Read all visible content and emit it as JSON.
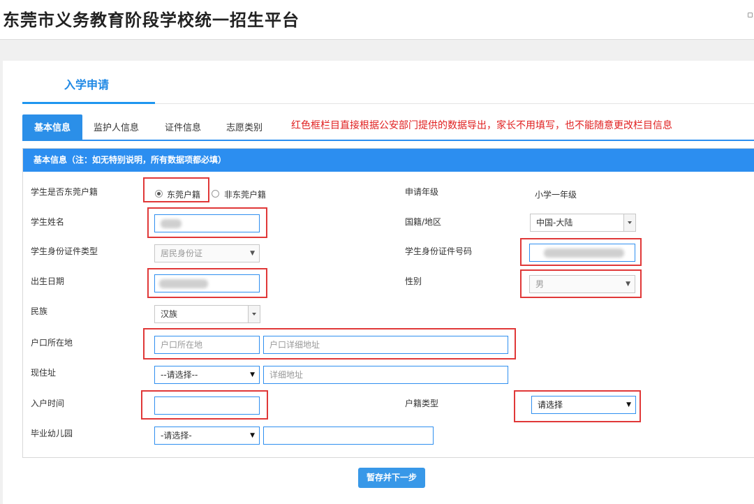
{
  "header": {
    "title": "东莞市义务教育阶段学校统一招生平台"
  },
  "page_tab": {
    "label": "入学申请"
  },
  "tabs": [
    {
      "label": "基本信息"
    },
    {
      "label": "监护人信息"
    },
    {
      "label": "证件信息"
    },
    {
      "label": "志愿类别"
    }
  ],
  "notice": "红色框栏目直接根据公安部门提供的数据导出，家长不用填写，也不能随意更改栏目信息",
  "panel": {
    "title": "基本信息（注：如无特别说明，所有数据项都必填）"
  },
  "form": {
    "dg_hukou": {
      "label": "学生是否东莞户籍",
      "options": [
        "东莞户籍",
        "非东莞户籍"
      ],
      "selected": "东莞户籍"
    },
    "grade": {
      "label": "申请年级",
      "value": "小学一年级"
    },
    "student_name": {
      "label": "学生姓名",
      "value": ""
    },
    "nationality": {
      "label": "国籍/地区",
      "value": "中国-大陆"
    },
    "id_type": {
      "label": "学生身份证件类型",
      "value": "居民身份证"
    },
    "id_number": {
      "label": "学生身份证件号码",
      "value": ""
    },
    "birth_date": {
      "label": "出生日期",
      "value": ""
    },
    "gender": {
      "label": "性别",
      "value": "男"
    },
    "ethnicity": {
      "label": "民族",
      "value": "汉族"
    },
    "hukou_location": {
      "label": "户口所在地",
      "placeholder": "户口所在地",
      "detail_placeholder": "户口详细地址"
    },
    "current_address": {
      "label": "现住址",
      "select_value": "--请选择--",
      "detail_placeholder": "详细地址"
    },
    "hukou_date": {
      "label": "入户时间",
      "value": ""
    },
    "hukou_type": {
      "label": "户籍类型",
      "value": "请选择"
    },
    "kindergarten": {
      "label": "毕业幼儿园",
      "select_value": "-请选择-",
      "value": ""
    }
  },
  "actions": {
    "save_next": "暂存并下一步"
  }
}
